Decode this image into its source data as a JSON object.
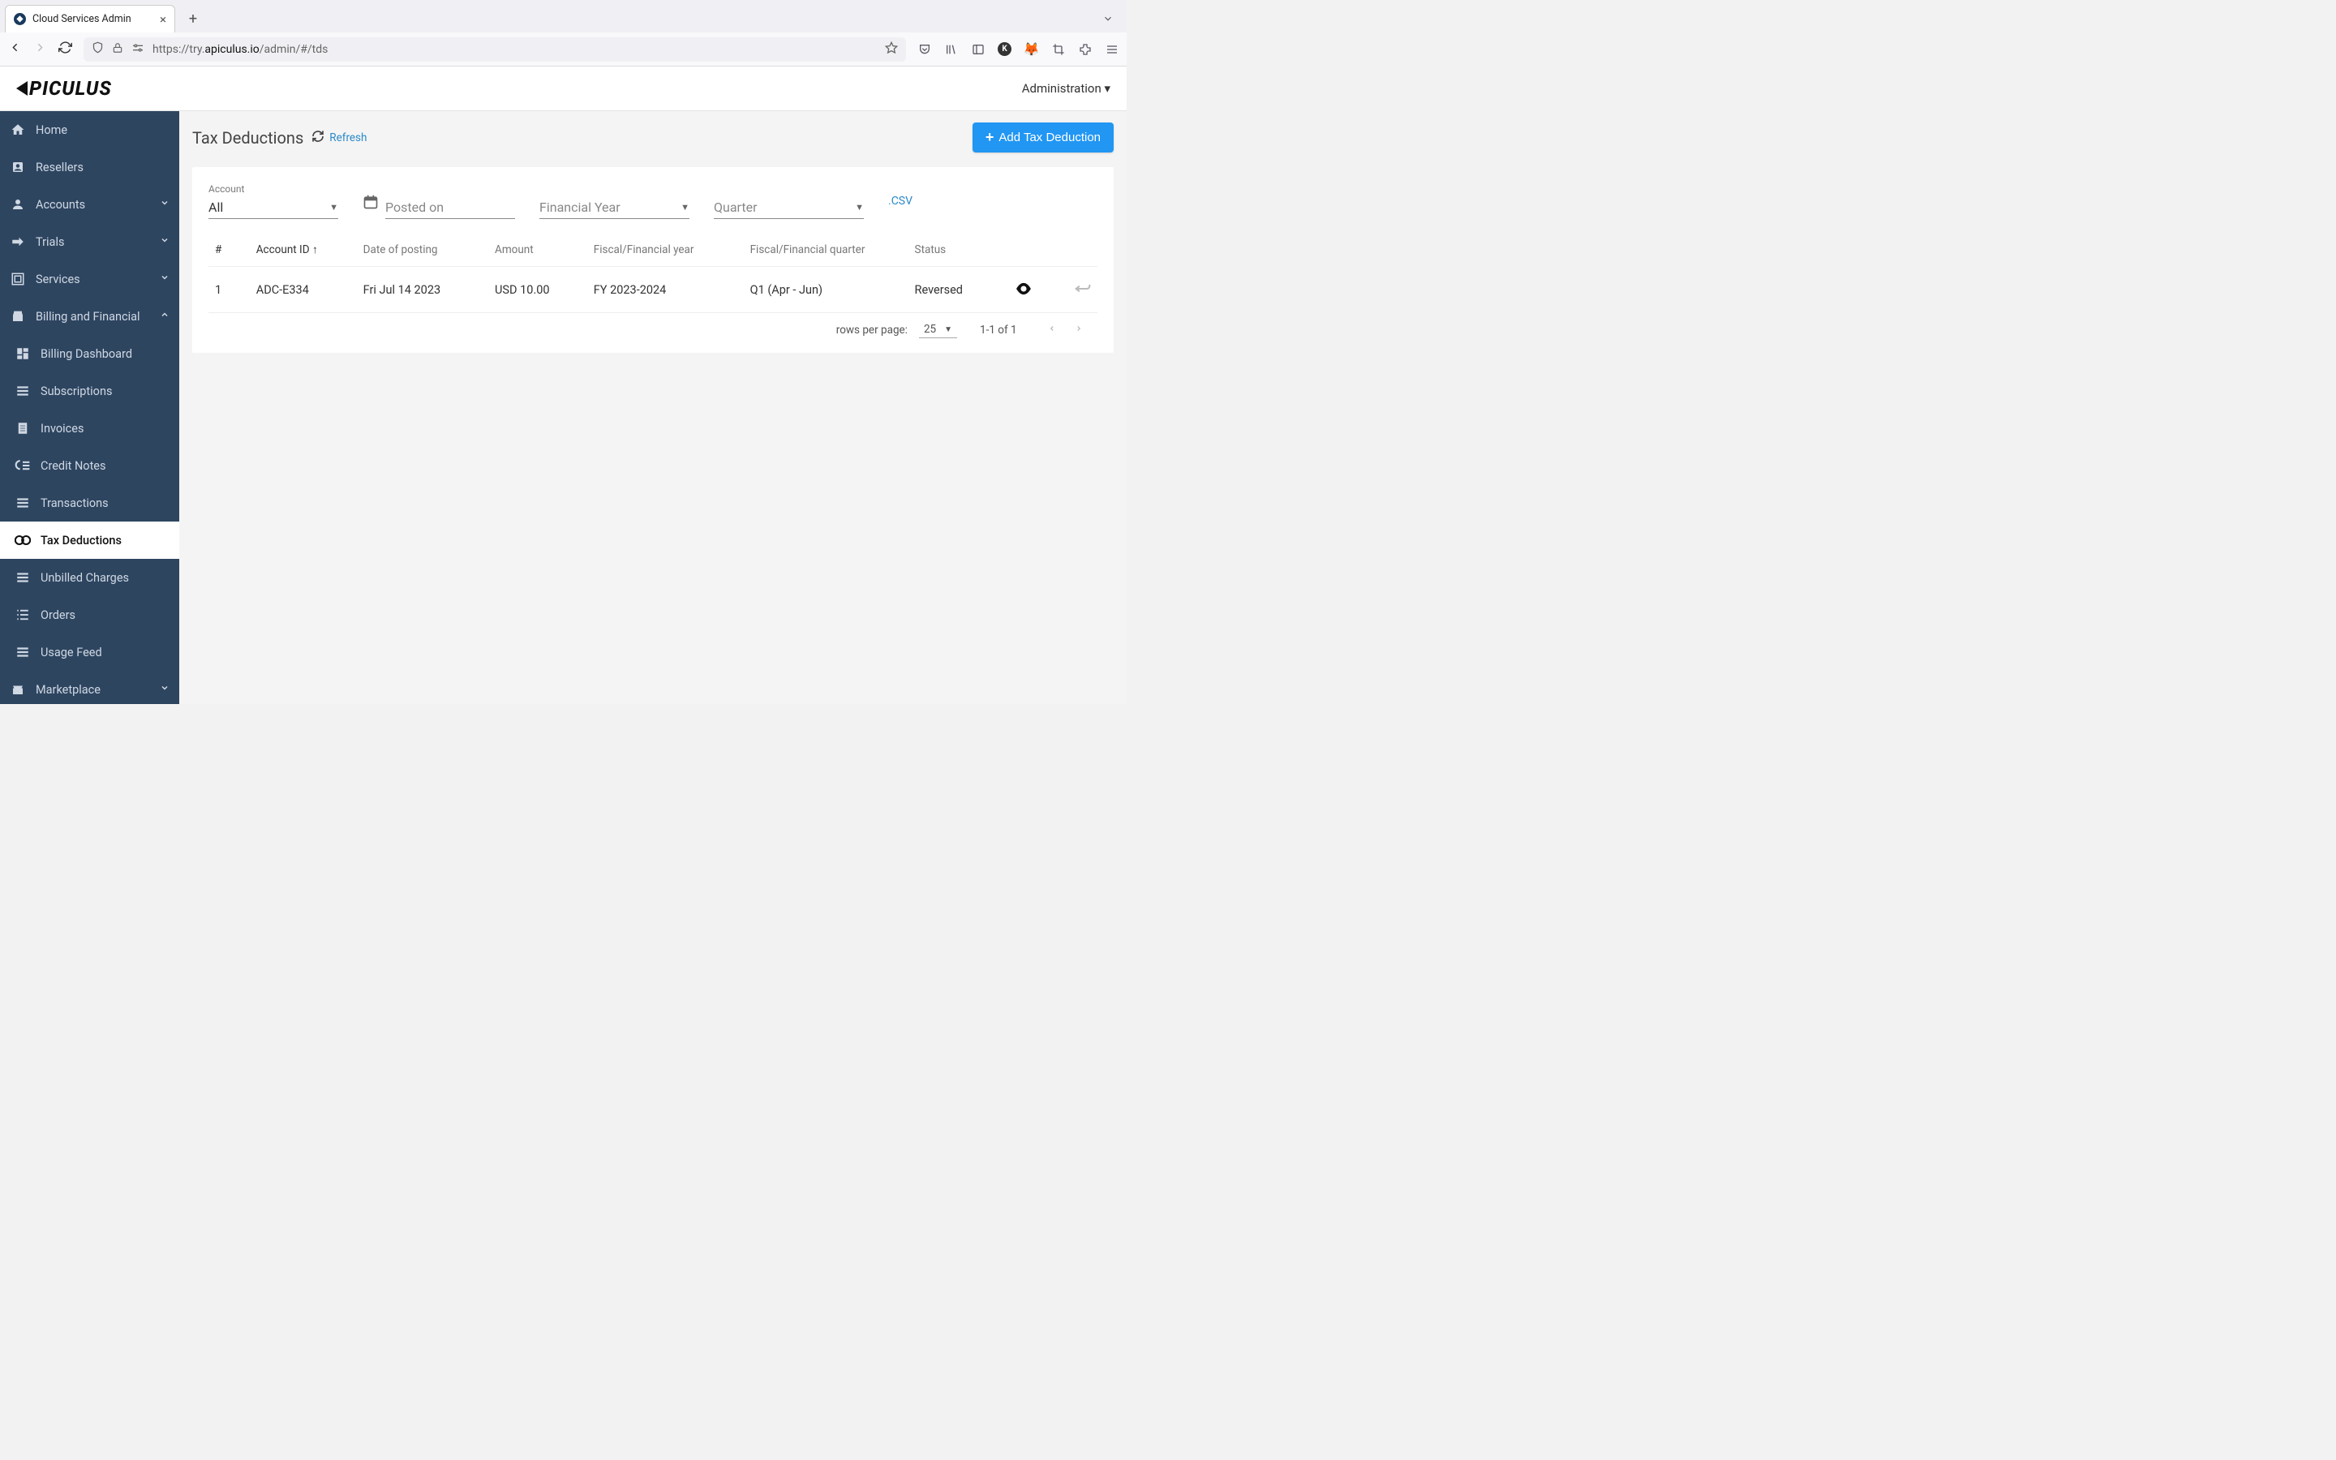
{
  "browser": {
    "tab_title": "Cloud Services Admin",
    "url_prefix": "https://try.",
    "url_domain": "apiculus.io",
    "url_path": "/admin/#/tds"
  },
  "header": {
    "logo_text": "PICULUS",
    "admin_label": "Administration"
  },
  "sidebar": {
    "home": "Home",
    "resellers": "Resellers",
    "accounts": "Accounts",
    "trials": "Trials",
    "services": "Services",
    "billing": "Billing and Financial",
    "billing_dashboard": "Billing Dashboard",
    "subscriptions": "Subscriptions",
    "invoices": "Invoices",
    "credit_notes": "Credit Notes",
    "transactions": "Transactions",
    "tax_deductions": "Tax Deductions",
    "unbilled": "Unbilled Charges",
    "orders": "Orders",
    "usage_feed": "Usage Feed",
    "marketplace": "Marketplace"
  },
  "page": {
    "title": "Tax Deductions",
    "refresh": "Refresh",
    "add_button": "Add Tax Deduction"
  },
  "filters": {
    "account_label": "Account",
    "account_value": "All",
    "posted_on": "Posted on",
    "financial_year": "Financial Year",
    "quarter": "Quarter",
    "csv": ".CSV"
  },
  "table": {
    "headers": {
      "num": "#",
      "account_id": "Account ID",
      "date": "Date of posting",
      "amount": "Amount",
      "fy": "Fiscal/Financial year",
      "fq": "Fiscal/Financial quarter",
      "status": "Status"
    },
    "rows": [
      {
        "num": "1",
        "account_id": "ADC-E334",
        "date": "Fri Jul 14 2023",
        "amount": "USD 10.00",
        "fy": "FY 2023-2024",
        "fq": "Q1 (Apr - Jun)",
        "status": "Reversed"
      }
    ]
  },
  "pager": {
    "rpp_label": "rows per page:",
    "rpp_value": "25",
    "range": "1-1 of 1"
  }
}
